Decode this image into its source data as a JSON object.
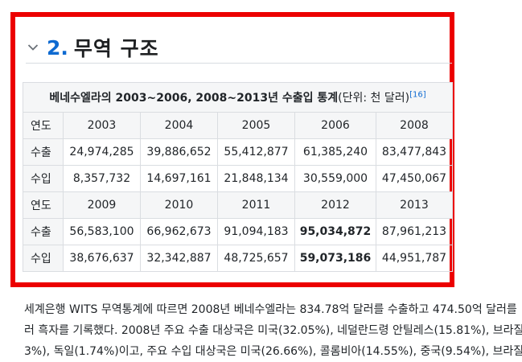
{
  "section": {
    "number": "2.",
    "title": "무역 구조"
  },
  "table": {
    "caption_bold": "베네수엘라의 2003~2006, 2008~2013년 수출입 통계",
    "caption_unit": "(단위: 천 달러)",
    "caption_ref": "[16]",
    "block1": {
      "header": [
        "연도",
        "2003",
        "2004",
        "2005",
        "2006",
        "2008"
      ],
      "export": [
        "수출",
        "24,974,285",
        "39,886,652",
        "55,412,877",
        "61,385,240",
        "83,477,843"
      ],
      "import": [
        "수입",
        "8,357,732",
        "14,697,161",
        "21,848,134",
        "30,559,000",
        "47,450,067"
      ]
    },
    "block2": {
      "header": [
        "연도",
        "2009",
        "2010",
        "2011",
        "2012",
        "2013"
      ],
      "export": [
        "수출",
        "56,583,100",
        "66,962,673",
        "91,094,183",
        "95,034,872",
        "87,961,213"
      ],
      "import": [
        "수입",
        "38,676,637",
        "32,342,887",
        "48,725,657",
        "59,073,186",
        "44,951,787"
      ]
    }
  },
  "paragraph": {
    "line1": "세계은행 WITS 무역통계에 따르면 2008년 베네수엘라는 834.78억 달러를 수출하고 474.50억 달러를",
    "line2": "러 흑자를 기록했다. 2008년 주요 수출 대상국은 미국(32.05%), 네덜란드령 안틸레스(15.81%), 브라질",
    "line3": "3%), 독일(1.74%)이고, 주요 수입 대상국은 미국(26.66%), 콜롬비아(14.55%), 중국(9.54%), 브라질"
  },
  "colors": {
    "highlight_frame": "#ec0000",
    "heading_number": "#0e6ad1",
    "link": "#0e6ad1"
  },
  "icons": {
    "collapse": "chevron-down-icon"
  }
}
